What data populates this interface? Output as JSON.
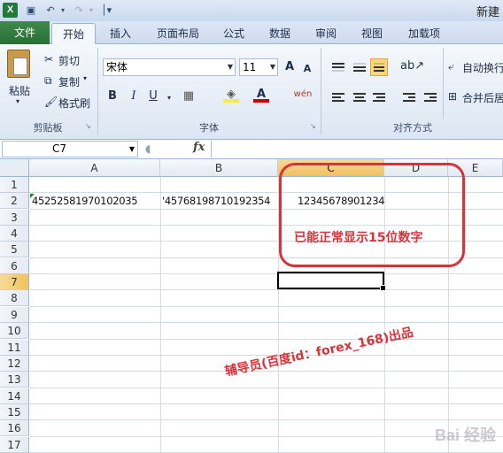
{
  "window": {
    "title": "新建"
  },
  "tabs": [
    "文件",
    "开始",
    "插入",
    "页面布局",
    "公式",
    "数据",
    "审阅",
    "视图",
    "加载项"
  ],
  "ribbon": {
    "clipboard": {
      "paste": "粘贴",
      "cut": "剪切",
      "copy": "复制",
      "format_painter": "格式刷",
      "label": "剪贴板"
    },
    "font": {
      "font_name": "宋体",
      "font_size": "11",
      "grow": "A",
      "shrink": "A",
      "bold": "B",
      "italic": "I",
      "underline": "U",
      "font_color": "A",
      "phonetic": "wén",
      "label": "字体"
    },
    "alignment": {
      "wrap": "自动换行",
      "merge": "合并后居",
      "label": "对齐方式"
    }
  },
  "formula_bar": {
    "name_box": "C7",
    "fx": "fx",
    "formula": ""
  },
  "grid": {
    "columns": [
      "A",
      "B",
      "C",
      "D",
      "E"
    ],
    "rows": [
      "1",
      "2",
      "3",
      "4",
      "5",
      "6",
      "7",
      "8",
      "9",
      "10",
      "11",
      "12",
      "13",
      "14",
      "15",
      "16",
      "17"
    ],
    "active_cell": "C7",
    "cells": {
      "A2": "452525819701020​35",
      "B2": "'457681987101923​54",
      "C2": "12345678901234"
    }
  },
  "annotations": {
    "note": "已能正常显示15位数字",
    "credit": "辅导员(百度id：forex_168)出品",
    "color": "#d6333a"
  },
  "watermark": "Bai 经验"
}
